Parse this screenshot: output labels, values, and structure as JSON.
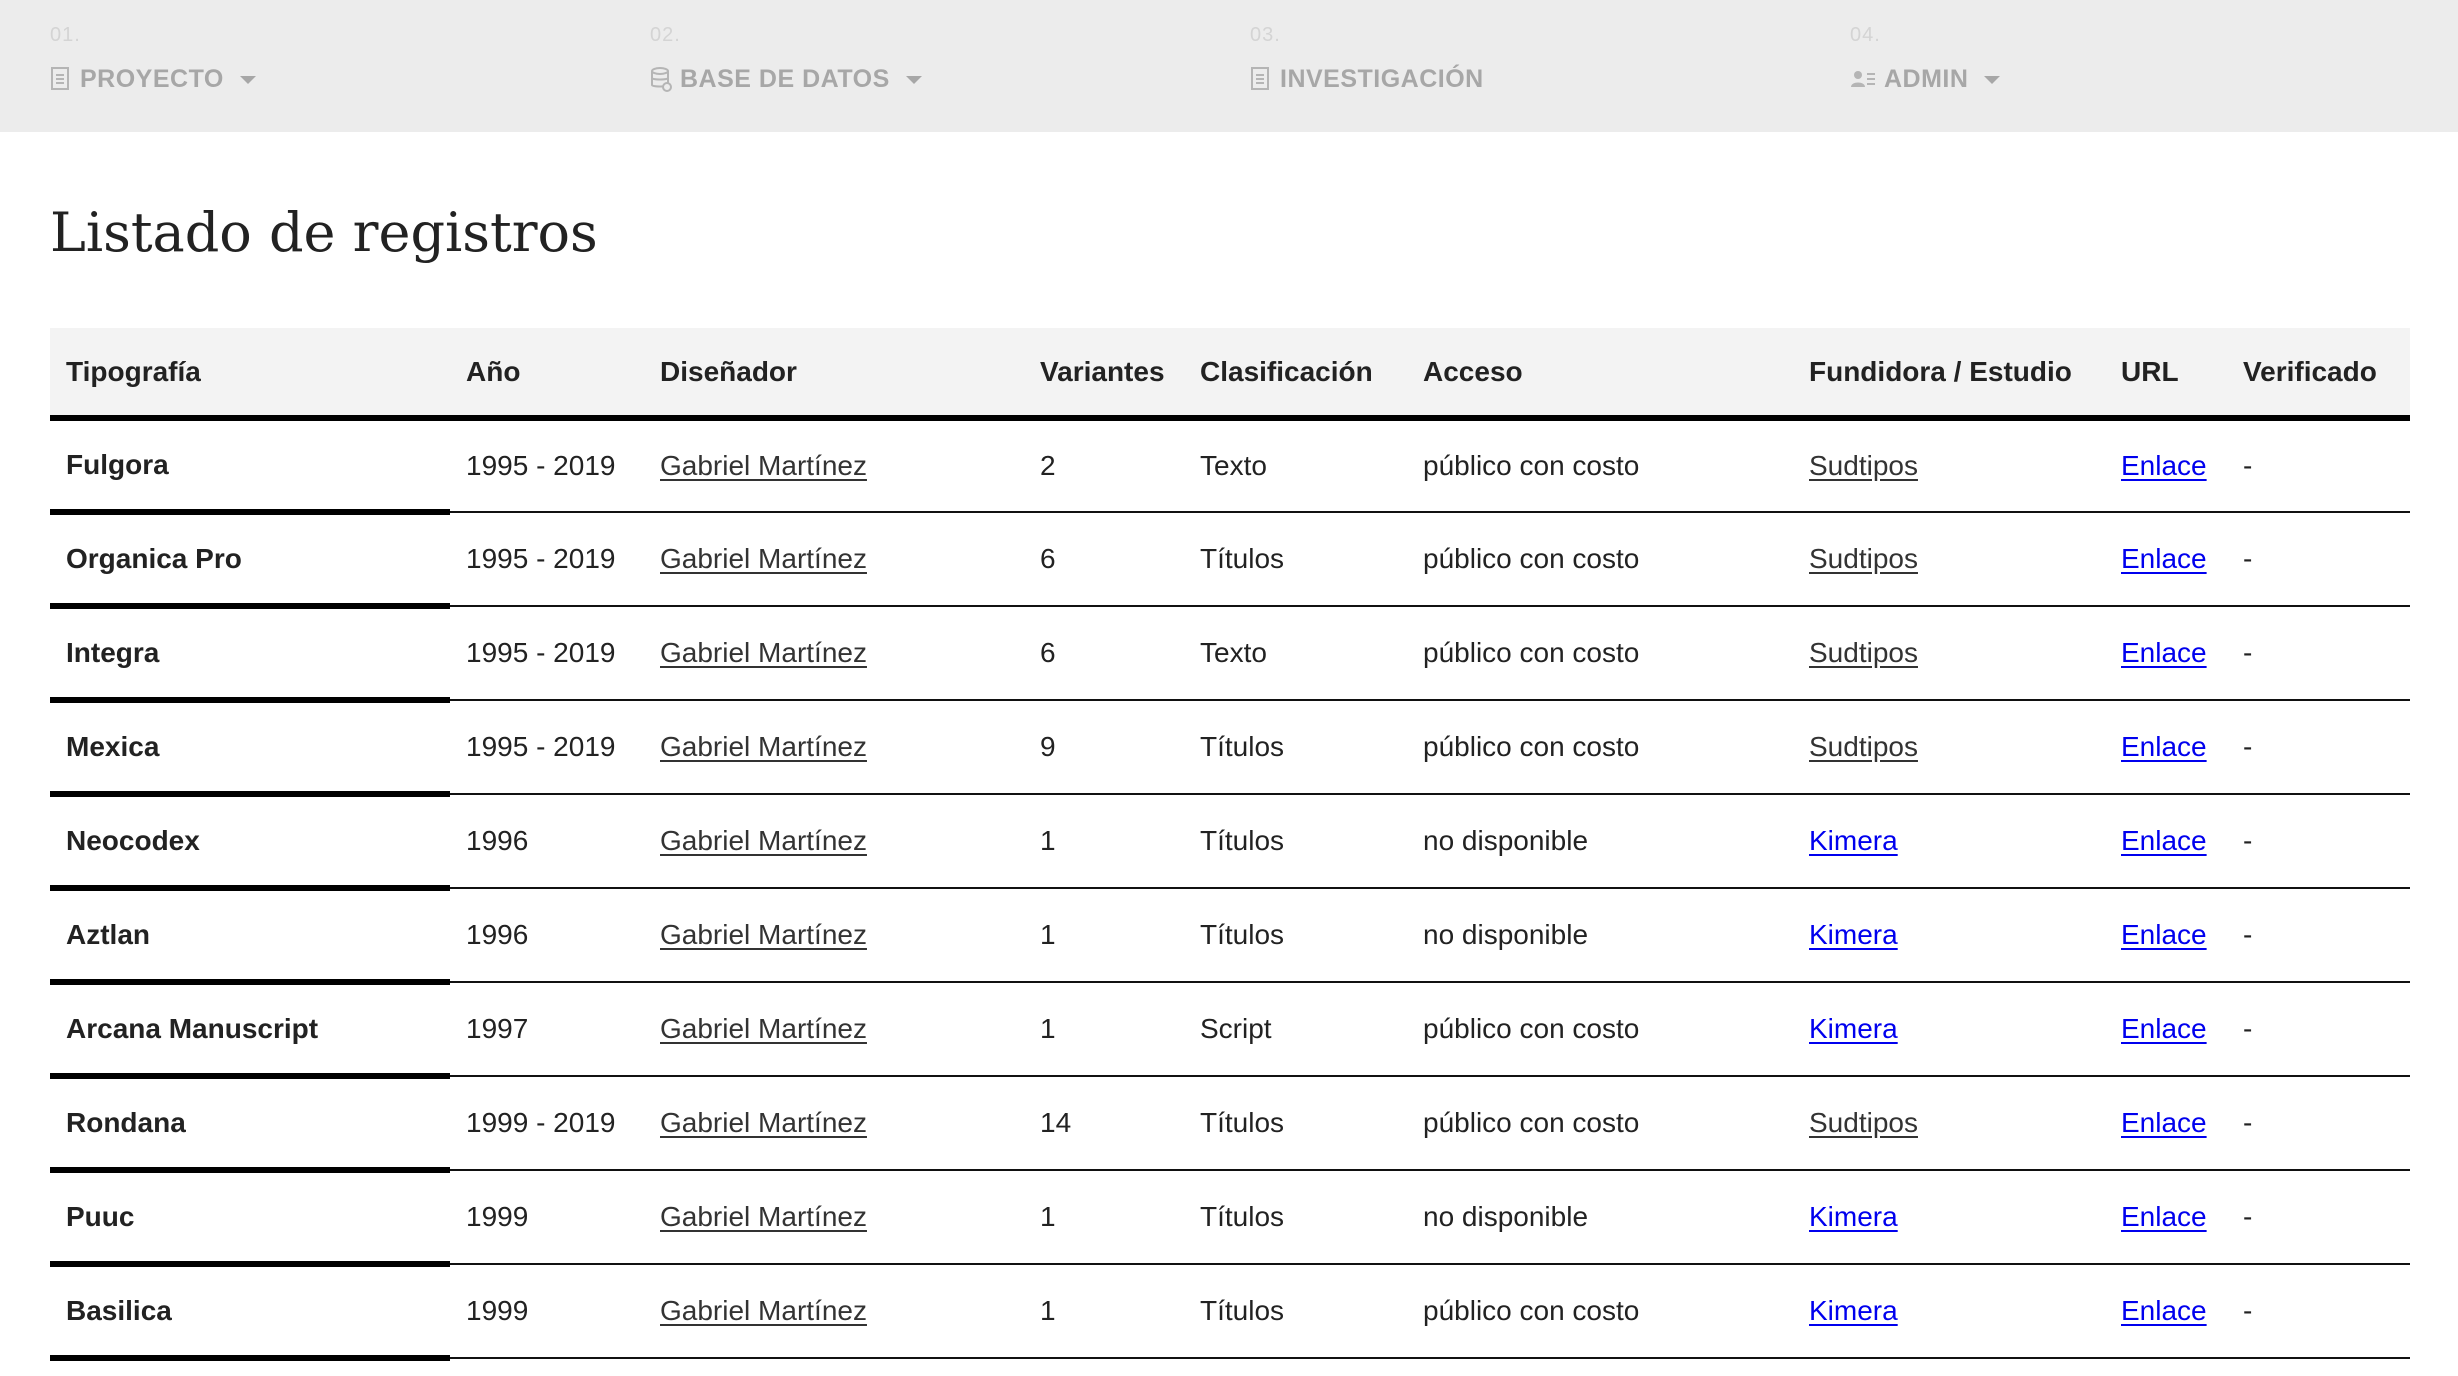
{
  "nav": {
    "items": [
      {
        "number": "01.",
        "label": "PROYECTO",
        "icon": "document-icon",
        "has_dropdown": true
      },
      {
        "number": "02.",
        "label": "BASE DE DATOS",
        "icon": "database-icon",
        "has_dropdown": true
      },
      {
        "number": "03.",
        "label": "INVESTIGACIÓN",
        "icon": "document-icon",
        "has_dropdown": false
      },
      {
        "number": "04.",
        "label": "ADMIN",
        "icon": "user-list-icon",
        "has_dropdown": true
      }
    ]
  },
  "page": {
    "title": "Listado de registros"
  },
  "table": {
    "headers": [
      "Tipografía",
      "Año",
      "Diseñador",
      "Variantes",
      "Clasificación",
      "Acceso",
      "Fundidora / Estudio",
      "URL",
      "Verificado"
    ],
    "rows": [
      {
        "name": "Fulgora",
        "year": "1995 - 2019",
        "designer": "Gabriel Martínez",
        "variants": "2",
        "classification": "Texto",
        "access": "público con costo",
        "foundry": "Sudtipos",
        "foundry_visited": true,
        "url": "Enlace",
        "verified": "-"
      },
      {
        "name": "Organica Pro",
        "year": "1995 - 2019",
        "designer": "Gabriel Martínez",
        "variants": "6",
        "classification": "Títulos",
        "access": "público con costo",
        "foundry": "Sudtipos",
        "foundry_visited": true,
        "url": "Enlace",
        "verified": "-"
      },
      {
        "name": "Integra",
        "year": "1995 - 2019",
        "designer": "Gabriel Martínez",
        "variants": "6",
        "classification": "Texto",
        "access": "público con costo",
        "foundry": "Sudtipos",
        "foundry_visited": true,
        "url": "Enlace",
        "verified": "-"
      },
      {
        "name": "Mexica",
        "year": "1995 - 2019",
        "designer": "Gabriel Martínez",
        "variants": "9",
        "classification": "Títulos",
        "access": "público con costo",
        "foundry": "Sudtipos",
        "foundry_visited": true,
        "url": "Enlace",
        "verified": "-"
      },
      {
        "name": "Neocodex",
        "year": "1996",
        "designer": "Gabriel Martínez",
        "variants": "1",
        "classification": "Títulos",
        "access": "no disponible",
        "foundry": "Kimera",
        "foundry_visited": false,
        "url": "Enlace",
        "verified": "-"
      },
      {
        "name": "Aztlan",
        "year": "1996",
        "designer": "Gabriel Martínez",
        "variants": "1",
        "classification": "Títulos",
        "access": "no disponible",
        "foundry": "Kimera",
        "foundry_visited": false,
        "url": "Enlace",
        "verified": "-"
      },
      {
        "name": "Arcana Manuscript",
        "year": "1997",
        "designer": "Gabriel Martínez",
        "variants": "1",
        "classification": "Script",
        "access": "público con costo",
        "foundry": "Kimera",
        "foundry_visited": false,
        "url": "Enlace",
        "verified": "-"
      },
      {
        "name": "Rondana",
        "year": "1999 - 2019",
        "designer": "Gabriel Martínez",
        "variants": "14",
        "classification": "Títulos",
        "access": "público con costo",
        "foundry": "Sudtipos",
        "foundry_visited": true,
        "url": "Enlace",
        "verified": "-"
      },
      {
        "name": "Puuc",
        "year": "1999",
        "designer": "Gabriel Martínez",
        "variants": "1",
        "classification": "Títulos",
        "access": "no disponible",
        "foundry": "Kimera",
        "foundry_visited": false,
        "url": "Enlace",
        "verified": "-"
      },
      {
        "name": "Basilica",
        "year": "1999",
        "designer": "Gabriel Martínez",
        "variants": "1",
        "classification": "Títulos",
        "access": "público con costo",
        "foundry": "Kimera",
        "foundry_visited": false,
        "url": "Enlace",
        "verified": "-"
      }
    ]
  },
  "colors": {
    "nav_background": "#ececec",
    "nav_text": "#a7a7a7",
    "link_unvisited": "#0000ee",
    "link_visited": "#333333",
    "header_background": "#f3f3f3"
  }
}
